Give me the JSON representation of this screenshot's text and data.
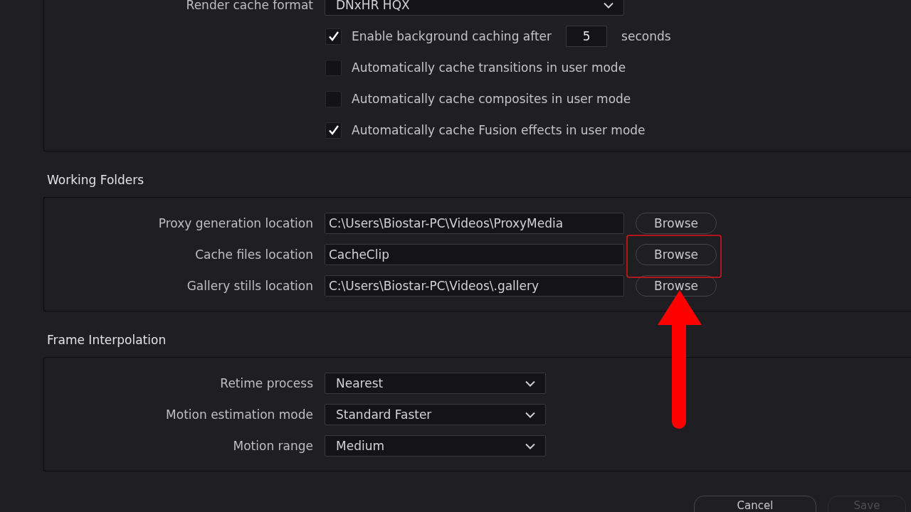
{
  "cache_panel": {
    "render_cache_format": {
      "label": "Render cache format",
      "value": "DNxHR HQX"
    },
    "options": [
      {
        "kind": "checkbox_number",
        "label": "Enable background caching after",
        "checked": true,
        "value": "5",
        "unit": "seconds"
      },
      {
        "kind": "checkbox",
        "label": "Automatically cache transitions in user mode",
        "checked": false
      },
      {
        "kind": "checkbox",
        "label": "Automatically cache composites in user mode",
        "checked": false
      },
      {
        "kind": "checkbox",
        "label": "Automatically cache Fusion effects in user mode",
        "checked": true
      }
    ]
  },
  "working_folders": {
    "title": "Working Folders",
    "rows": [
      {
        "label": "Proxy generation location",
        "value": "C:\\Users\\Biostar-PC\\Videos\\ProxyMedia",
        "button": "Browse"
      },
      {
        "label": "Cache files location",
        "value": "CacheClip",
        "button": "Browse"
      },
      {
        "label": "Gallery stills location",
        "value": "C:\\Users\\Biostar-PC\\Videos\\.gallery",
        "button": "Browse"
      }
    ]
  },
  "frame_interpolation": {
    "title": "Frame Interpolation",
    "rows": [
      {
        "label": "Retime process",
        "value": "Nearest"
      },
      {
        "label": "Motion estimation mode",
        "value": "Standard Faster"
      },
      {
        "label": "Motion range",
        "value": "Medium"
      }
    ]
  },
  "footer_buttons": [
    {
      "label": "Cancel",
      "disabled": false
    },
    {
      "label": "Save",
      "disabled": true
    }
  ],
  "annotations": {
    "highlight_frame": true,
    "arrow": true
  }
}
